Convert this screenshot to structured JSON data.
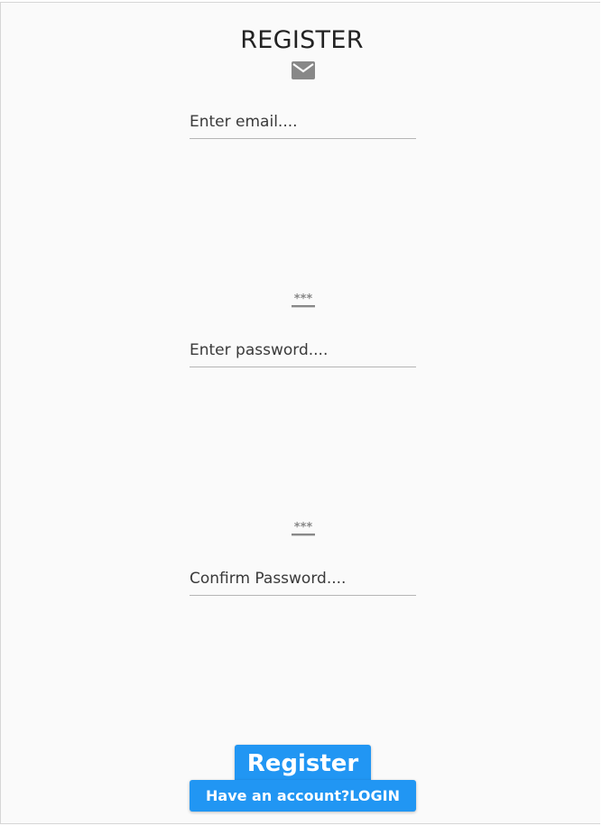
{
  "form": {
    "title": "REGISTER",
    "email": {
      "icon": "mail-icon",
      "placeholder": "Enter email...."
    },
    "password": {
      "icon": "password-icon",
      "placeholder": "Enter password...."
    },
    "confirm_password": {
      "icon": "password-icon",
      "placeholder": "Confirm Password...."
    },
    "register_label": "Register",
    "login_label": "Have an account?LOGIN"
  },
  "colors": {
    "button": "#2196f3",
    "icon": "#888888",
    "underline": "#b5b5b5"
  }
}
